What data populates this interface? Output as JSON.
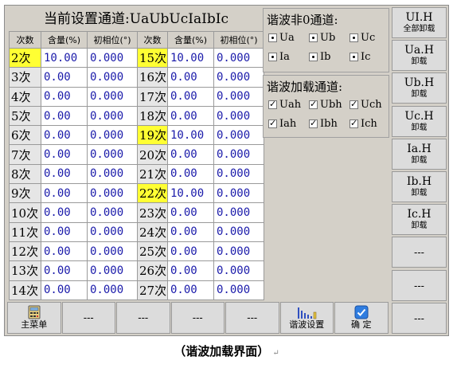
{
  "title": "当前设置通道:UaUbUcIaIbIc",
  "headers": [
    "次数",
    "含量(%)",
    "初相位(°)",
    "次数",
    "含量(%)",
    "初相位(°)"
  ],
  "left_rows": [
    {
      "order": "2次",
      "content": "10.00",
      "phase": "0.000",
      "highlight": true
    },
    {
      "order": "3次",
      "content": "0.00",
      "phase": "0.000",
      "highlight": false
    },
    {
      "order": "4次",
      "content": "0.00",
      "phase": "0.000",
      "highlight": false
    },
    {
      "order": "5次",
      "content": "0.00",
      "phase": "0.000",
      "highlight": false
    },
    {
      "order": "6次",
      "content": "0.00",
      "phase": "0.000",
      "highlight": false
    },
    {
      "order": "7次",
      "content": "0.00",
      "phase": "0.000",
      "highlight": false
    },
    {
      "order": "8次",
      "content": "0.00",
      "phase": "0.000",
      "highlight": false
    },
    {
      "order": "9次",
      "content": "0.00",
      "phase": "0.000",
      "highlight": false
    },
    {
      "order": "10次",
      "content": "0.00",
      "phase": "0.000",
      "highlight": false
    },
    {
      "order": "11次",
      "content": "0.00",
      "phase": "0.000",
      "highlight": false
    },
    {
      "order": "12次",
      "content": "0.00",
      "phase": "0.000",
      "highlight": false
    },
    {
      "order": "13次",
      "content": "0.00",
      "phase": "0.000",
      "highlight": false
    },
    {
      "order": "14次",
      "content": "0.00",
      "phase": "0.000",
      "highlight": false
    }
  ],
  "right_rows": [
    {
      "order": "15次",
      "content": "10.00",
      "phase": "0.000",
      "highlight": true
    },
    {
      "order": "16次",
      "content": "0.00",
      "phase": "0.000",
      "highlight": false
    },
    {
      "order": "17次",
      "content": "0.00",
      "phase": "0.000",
      "highlight": false
    },
    {
      "order": "18次",
      "content": "0.00",
      "phase": "0.000",
      "highlight": false
    },
    {
      "order": "19次",
      "content": "10.00",
      "phase": "0.000",
      "highlight": true
    },
    {
      "order": "20次",
      "content": "0.00",
      "phase": "0.000",
      "highlight": false
    },
    {
      "order": "21次",
      "content": "0.00",
      "phase": "0.000",
      "highlight": false
    },
    {
      "order": "22次",
      "content": "10.00",
      "phase": "0.000",
      "highlight": true
    },
    {
      "order": "23次",
      "content": "0.00",
      "phase": "0.000",
      "highlight": false
    },
    {
      "order": "24次",
      "content": "0.00",
      "phase": "0.000",
      "highlight": false
    },
    {
      "order": "25次",
      "content": "0.00",
      "phase": "0.000",
      "highlight": false
    },
    {
      "order": "26次",
      "content": "0.00",
      "phase": "0.000",
      "highlight": false
    },
    {
      "order": "27次",
      "content": "0.00",
      "phase": "0.000",
      "highlight": false
    }
  ],
  "nonzero_panel": {
    "title": "谐波非0通道:",
    "items": [
      {
        "label": "Ua",
        "checked": true
      },
      {
        "label": "Ub",
        "checked": true
      },
      {
        "label": "Uc",
        "checked": true
      },
      {
        "label": "Ia",
        "checked": true
      },
      {
        "label": "Ib",
        "checked": true
      },
      {
        "label": "Ic",
        "checked": true
      }
    ]
  },
  "load_panel": {
    "title": "谐波加载通道:",
    "items": [
      {
        "label": "Uah",
        "checked": true
      },
      {
        "label": "Ubh",
        "checked": true
      },
      {
        "label": "Uch",
        "checked": true
      },
      {
        "label": "Iah",
        "checked": true
      },
      {
        "label": "Ibh",
        "checked": true
      },
      {
        "label": "Ich",
        "checked": true
      }
    ]
  },
  "side_buttons": [
    {
      "l1": "UI.H",
      "l2": "全部卸载"
    },
    {
      "l1": "Ua.H",
      "l2": "卸载"
    },
    {
      "l1": "Ub.H",
      "l2": "卸载"
    },
    {
      "l1": "Uc.H",
      "l2": "卸载"
    },
    {
      "l1": "Ia.H",
      "l2": "卸载"
    },
    {
      "l1": "Ib.H",
      "l2": "卸载"
    },
    {
      "l1": "Ic.H",
      "l2": "卸载"
    },
    {
      "l1": "---",
      "l2": ""
    },
    {
      "l1": "---",
      "l2": ""
    },
    {
      "l1": "---",
      "l2": ""
    }
  ],
  "bottom_buttons": [
    {
      "label": "主菜单",
      "icon": "calculator-icon"
    },
    {
      "label": "---",
      "icon": ""
    },
    {
      "label": "---",
      "icon": ""
    },
    {
      "label": "---",
      "icon": ""
    },
    {
      "label": "---",
      "icon": ""
    },
    {
      "label": "谐波设置",
      "icon": "harmonic-bars-icon"
    },
    {
      "label": "确 定",
      "icon": "confirm-check-icon"
    }
  ],
  "caption": "（谐波加载界面）",
  "caption_mark": "↵",
  "colors": {
    "highlight": "#ffff33",
    "value_text": "#1a1aaa",
    "panel": "#d4d0c8"
  }
}
